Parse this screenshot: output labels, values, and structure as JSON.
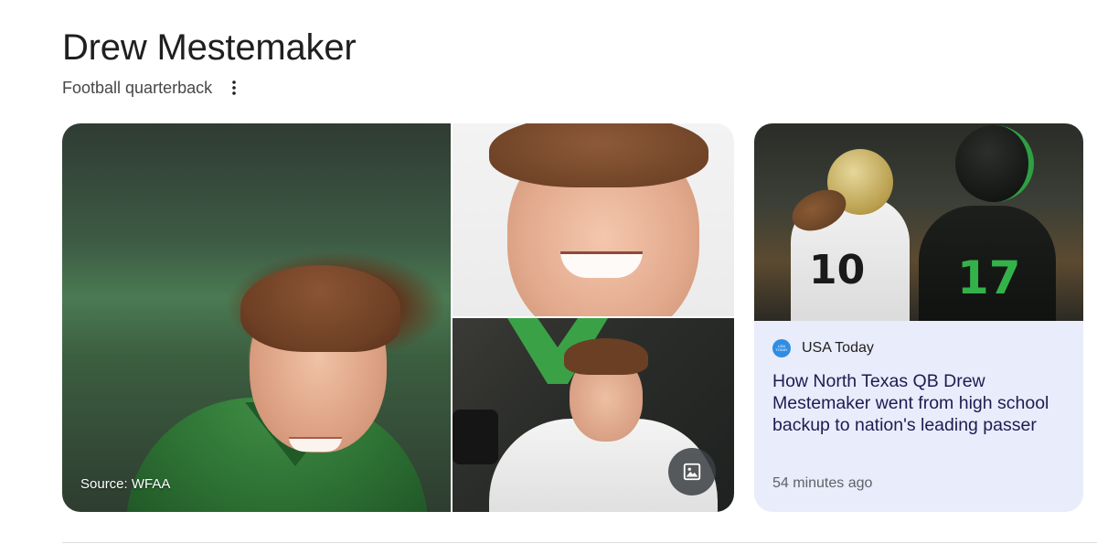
{
  "entity": {
    "name": "Drew Mestemaker",
    "description": "Football quarterback",
    "more_icon": "more-vert-icon"
  },
  "gallery": {
    "main_image": {
      "source_label": "Source: WFAA"
    },
    "open_gallery_icon": "image-icon"
  },
  "news": {
    "publisher": "USA Today",
    "publisher_logo_text": "USA TODAY",
    "headline": "How North Texas QB Drew Mestemaker went from high school backup to nation's leading passer",
    "timestamp": "54 minutes ago",
    "image_numbers": {
      "left_player": "10",
      "right_player": "17"
    }
  },
  "colors": {
    "card_background": "#e9ecfa",
    "publisher_logo": "#2f8de4",
    "divider": "#dadce0"
  }
}
